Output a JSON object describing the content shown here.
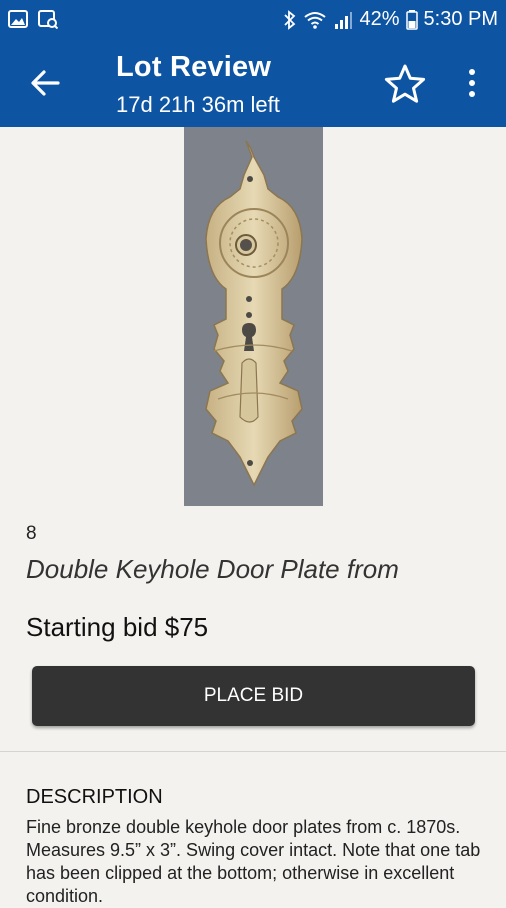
{
  "status_bar": {
    "battery": "42%",
    "time": "5:30 PM"
  },
  "app_bar": {
    "title": "Lot Review",
    "time_left": "17d 21h 36m left"
  },
  "lot": {
    "number": "8",
    "title": "Double Keyhole Door Plate from",
    "starting_bid": "Starting bid $75",
    "place_bid_label": "PLACE BID",
    "description_heading": "DESCRIPTION",
    "description": "Fine bronze double keyhole door plates from c. 1870s. Measures 9.5” x 3”. Swing cover intact. Note that one tab has been clipped at the bottom; otherwise in excellent condition."
  },
  "colors": {
    "accent": "#0d54a3",
    "button": "#333333",
    "background": "#f3f2ef"
  }
}
